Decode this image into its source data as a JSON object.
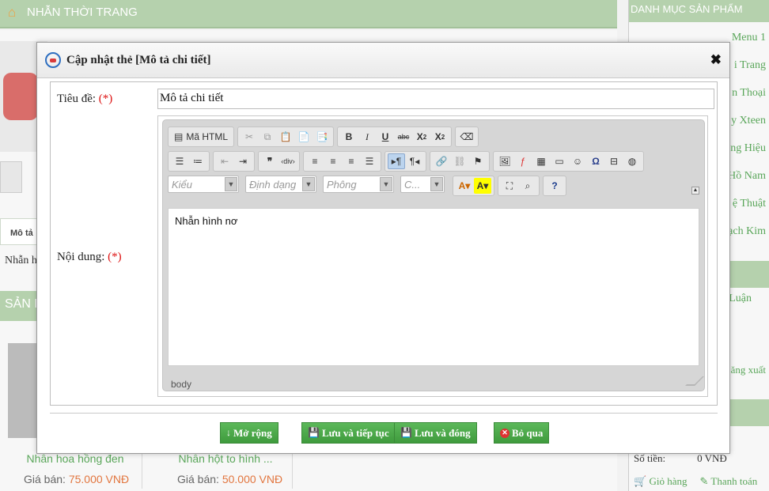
{
  "background": {
    "breadcrumb": "NHẪN THỜI TRANG",
    "tab_label": "Mô tả",
    "desc_text": "Nhẫn h",
    "section_title": "SẢN P",
    "products": [
      {
        "name": "Nhẫn hoa hồng đen",
        "price_label": "Giá bán:",
        "price": "75.000 VNĐ"
      },
      {
        "name": "Nhẫn hột to hình ...",
        "price_label": "Giá bán:",
        "price": "50.000 VNĐ"
      }
    ],
    "sidebar_title": "DANH MỤC SẢN PHẨM",
    "sidebar_items": [
      "Menu 1",
      "i Trang",
      "n Thoại",
      "y Xteen",
      "ng Hiệu",
      "Hồ Nam",
      "ệ Thuật",
      "ạch Kim"
    ],
    "sidebar_extra": [
      "Luận",
      "ăng xuất"
    ],
    "cart_amount_label": "Số tiền:",
    "cart_amount": "0 VNĐ",
    "cart_link": "Giỏ hàng",
    "checkout_link": "Thanh toán"
  },
  "modal": {
    "title": "Cập nhật thẻ [Mô tả chi tiết]",
    "title_label": "Tiêu đề:",
    "required_mark": "(*)",
    "title_value": "Mô tả chi tiết",
    "content_label": "Nội dung:",
    "editor": {
      "source_button": "Mã HTML",
      "style_combo": "Kiểu",
      "format_combo": "Định dạng",
      "font_combo": "Phông",
      "size_combo": "C...",
      "content_text": "Nhẫn hình nơ",
      "status_path": "body"
    },
    "buttons": {
      "expand": "Mở rộng",
      "save_continue": "Lưu và tiếp tục",
      "save_close": "Lưu và đóng",
      "cancel": "Bỏ qua"
    }
  },
  "colors": {
    "accent_green": "#4aa548",
    "header_green": "#b5d1ad",
    "required_red": "#d11111"
  }
}
